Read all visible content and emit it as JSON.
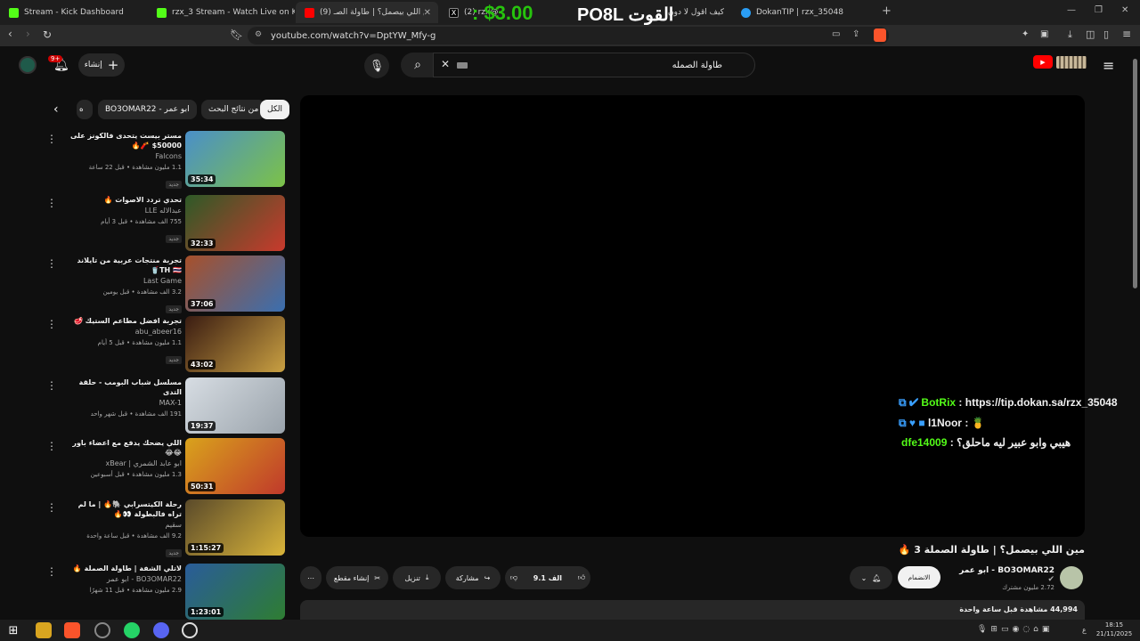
{
  "browser": {
    "tabs": [
      {
        "label": "Stream - Kick Dashboard",
        "color": "#53fc18"
      },
      {
        "label": "rzx_3 Stream - Watch Live on Kick",
        "color": "#53fc18"
      },
      {
        "label": "(9) مين اللي بيصمل؟ | طاولة الصـ",
        "color": "#ff0000"
      },
      {
        "label": "(2) rzx@",
        "color": "#ffffff"
      },
      {
        "label": "كيف أقول لا دون",
        "color": "#888888"
      },
      {
        "label": "DokanTIP | rzx_35048",
        "color": "#2a9df4"
      }
    ],
    "stream_overlay": {
      "price": ": $3.00",
      "name": "PO8L القوت"
    },
    "url": "youtube.com/watch?v=DptYW_Mfy-g"
  },
  "youtube": {
    "search_value": "طاولة الصمله",
    "create_label": "إنشاء",
    "notif_badge": "9+",
    "chips": [
      "الكل",
      "من نتائج البحث",
      "BO3OMAR22 - ابو عمر",
      "ه"
    ],
    "video_title": "مين اللي بيصمل؟ | طاولة الصملة 3 🔥",
    "channel_name": "BO3OMAR22 - ابو عمر",
    "subscribers": "2.72 مليون مشترك",
    "subscribe_label": "الانضمام",
    "likes": "9.1 الف",
    "share_label": "مشاركة",
    "download_label": "تنزيل",
    "clip_label": "إنشاء مقطع",
    "views_line": "44,994 مشاهدة قبل ساعة واحدة"
  },
  "chat": [
    {
      "user": "BotRix",
      "sep": ":",
      "msg": "https://tip.dokan.sa/rzx_35048",
      "color": "#53fc18"
    },
    {
      "user": "l1Noor",
      "sep": ":",
      "msg": "🍍",
      "color": "#ffffff"
    },
    {
      "user": "dfe14009",
      "sep": ":",
      "msg": "هيبي وابو عبير ليه ماحلق؟",
      "color": "#53fc18"
    }
  ],
  "recommendations": [
    {
      "title": "مستر بيست يتحدى فالكونز على 50000$ 🧨🔥",
      "channel": "Falcons",
      "meta": "1.1 مليون مشاهدة • قبل 22 ساعة",
      "duration": "35:34",
      "new": "جديد",
      "colors": [
        "#4a8fc9",
        "#7cc247"
      ]
    },
    {
      "title": "تحدي تردد الاصوات 🔥",
      "channel": "عبدالاله LLE",
      "meta": "755 الف مشاهدة • قبل 3 أيام",
      "duration": "32:33",
      "new": "جديد",
      "colors": [
        "#2d5a27",
        "#c93a2d"
      ]
    },
    {
      "title": "تجربة منتجات عربية من تايلاند TH 🇹🇭🥤",
      "channel": "Last Game",
      "meta": "3.2 الف مشاهدة • قبل يومين",
      "duration": "37:06",
      "new": "جديد",
      "colors": [
        "#a8502a",
        "#3a6fb0"
      ]
    },
    {
      "title": "تجربة افضل مطاعم الستيك 🥩",
      "channel": "abu_abeer16",
      "meta": "1.1 مليون مشاهدة • قبل 5 أيام",
      "duration": "43:02",
      "new": "جديد",
      "colors": [
        "#3a1c12",
        "#c9a042"
      ]
    },
    {
      "title": "مسلسل شباب البومب - حلقة التدى",
      "channel": "MAX-1",
      "meta": "191 الف مشاهدة • قبل شهر واحد",
      "duration": "19:37",
      "new": "",
      "colors": [
        "#d7dde3",
        "#9aa3ab"
      ]
    },
    {
      "title": "اللي يضحك يدفع مع اعضاء باور 😂😂",
      "channel": "ابو عابد الشمري | xBear",
      "meta": "1.3 مليون مشاهدة • قبل أسبوعين",
      "duration": "50:31",
      "new": "",
      "colors": [
        "#d9a31c",
        "#c0392b"
      ]
    },
    {
      "title": "رحلة الكيتسرابي 🐘🔥 | ما لم تراه فالبطولة 👀🔥",
      "channel": "سقيم",
      "meta": "9.2 الف مشاهدة • قبل ساعة واحدة",
      "duration": "1:15:27",
      "new": "جديد",
      "colors": [
        "#5a4a2a",
        "#d9b43a"
      ]
    },
    {
      "title": "لاتلي الشفة | طاولة الصملة 🔥",
      "channel": "BO3OMAR22 - ابو عمر",
      "meta": "2.9 مليون مشاهدة • قبل 11 شهرًا",
      "duration": "1:23:01",
      "new": "",
      "colors": [
        "#2a5c9a",
        "#2e7d32"
      ]
    }
  ],
  "taskbar": {
    "time": "18:15",
    "date": "21/11/2025",
    "lang": "ع"
  }
}
